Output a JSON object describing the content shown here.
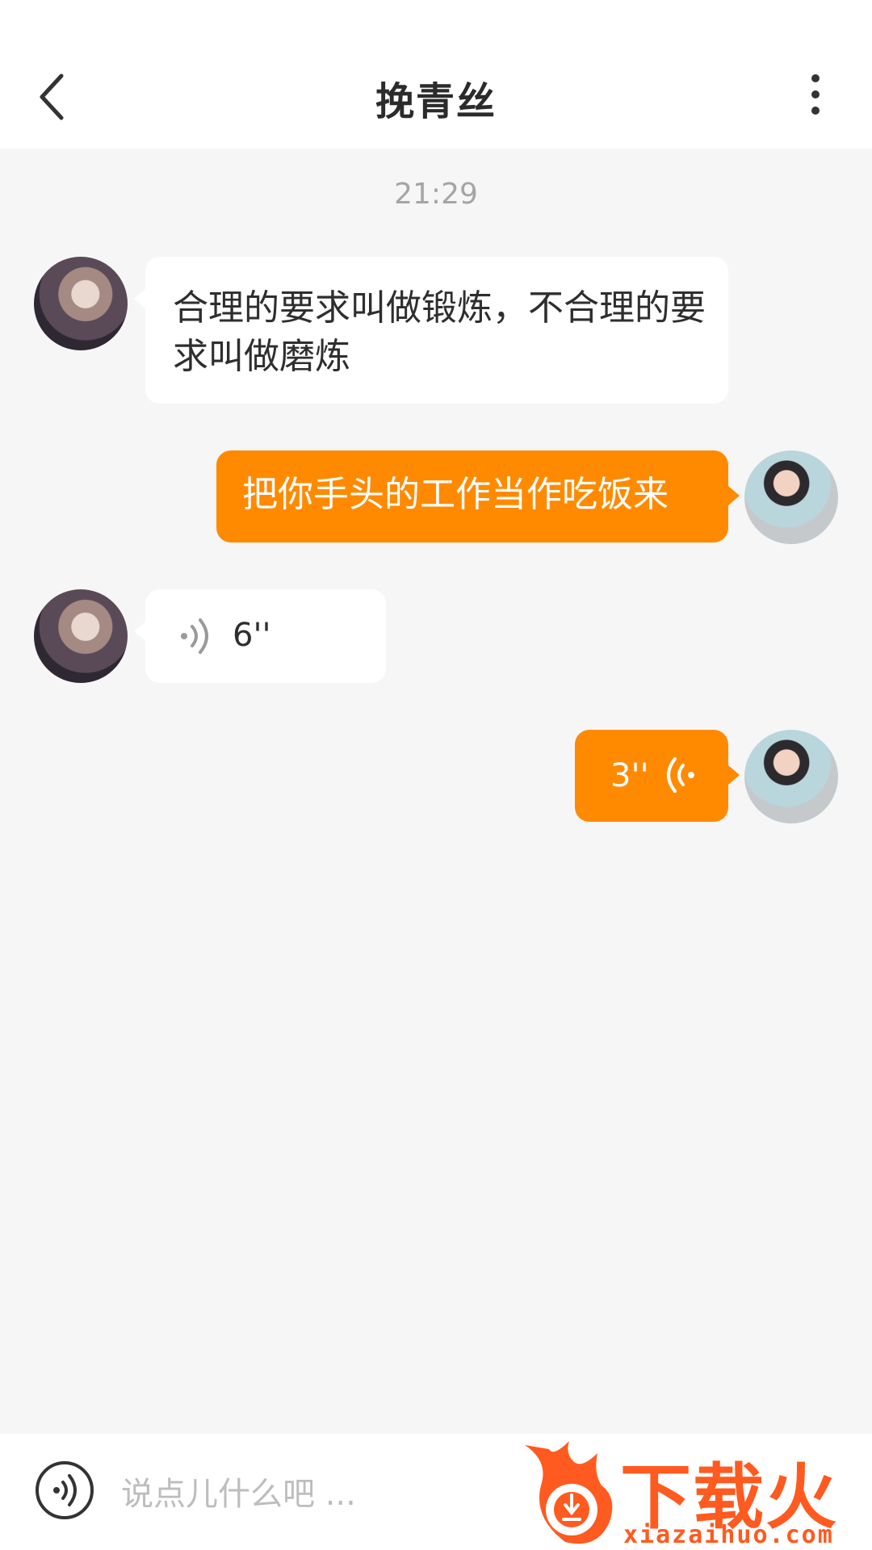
{
  "header": {
    "title": "挽青丝",
    "back_icon": "chevron-left-icon",
    "more_icon": "more-vertical-icon"
  },
  "chat": {
    "timestamp": "21:29",
    "messages": [
      {
        "side": "incoming",
        "type": "text",
        "text": "合理的要求叫做锻炼，不合理的要求叫做磨炼"
      },
      {
        "side": "outgoing",
        "type": "text",
        "text": "把你手头的工作当作吃饭来"
      },
      {
        "side": "incoming",
        "type": "voice",
        "duration": "6''"
      },
      {
        "side": "outgoing",
        "type": "voice",
        "duration": "3''"
      }
    ]
  },
  "composer": {
    "placeholder": "说点儿什么吧 ...",
    "voice_icon": "voice-toggle-icon"
  },
  "watermark": {
    "brand": "下载火",
    "url": "xiazaihuo.com"
  },
  "colors": {
    "accent": "#ff8a00",
    "background": "#f6f6f6",
    "watermark": "#ff5a1f"
  }
}
